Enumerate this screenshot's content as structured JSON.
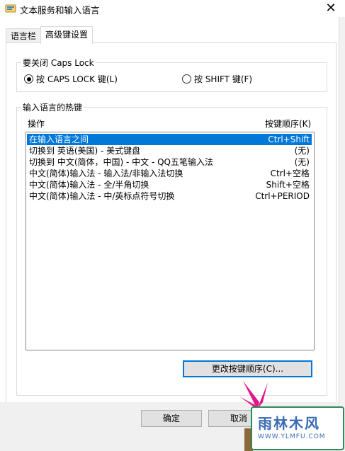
{
  "window": {
    "title": "文本服务和输入语言",
    "close_glyph": "✕"
  },
  "tabs": [
    {
      "label": "语言栏",
      "active": false
    },
    {
      "label": "高级键设置",
      "active": true
    }
  ],
  "caps_group": {
    "title": "要关闭 Caps Lock",
    "options": [
      {
        "label": "按 CAPS LOCK 键(L)",
        "selected": true
      },
      {
        "label": "按 SHIFT 键(F)",
        "selected": false
      }
    ]
  },
  "hotkeys_group": {
    "title": "输入语言的热键",
    "col_action": "操作",
    "col_keys": "按键顺序(K)",
    "rows": [
      {
        "action": "在输入语言之间",
        "keys": "Ctrl+Shift",
        "selected": true
      },
      {
        "action": "切换到 英语(美国) - 美式键盘",
        "keys": "(无)",
        "selected": false
      },
      {
        "action": "切换到 中文(简体，中国) - 中文 - QQ五笔输入法",
        "keys": "(无)",
        "selected": false
      },
      {
        "action": "中文(简体)输入法 - 输入法/非输入法切换",
        "keys": "Ctrl+空格",
        "selected": false
      },
      {
        "action": "中文(简体)输入法 - 全/半角切换",
        "keys": "Shift+空格",
        "selected": false
      },
      {
        "action": "中文(简体)输入法 - 中/英标点符号切换",
        "keys": "Ctrl+PERIOD",
        "selected": false
      }
    ],
    "change_button": "更改按键顺序(C)..."
  },
  "footer": {
    "ok": "确定",
    "cancel": "取消"
  },
  "watermark": {
    "main": "雨林木风",
    "url": "WWW.YLMFU.COM"
  },
  "colors": {
    "selection": "#0078d7",
    "focus_border": "#0078d7",
    "watermark_text": "#3a6bb5",
    "watermark_border": "#2e8b57"
  }
}
